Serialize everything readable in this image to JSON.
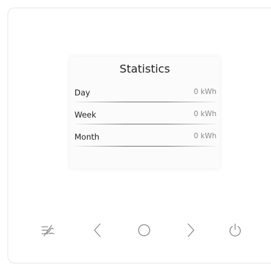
{
  "screen": {
    "title": "Statistics",
    "rows": [
      {
        "label": "Day",
        "value": "0 kWh"
      },
      {
        "label": "Week",
        "value": "0 kWh"
      },
      {
        "label": "Month",
        "value": "0 kWh"
      }
    ]
  },
  "buttons": [
    {
      "name": "fan-off-button",
      "icon": "fan-off-icon"
    },
    {
      "name": "previous-button",
      "icon": "chevron-left-icon"
    },
    {
      "name": "ok-button",
      "icon": "circle-icon"
    },
    {
      "name": "next-button",
      "icon": "chevron-right-icon"
    },
    {
      "name": "power-button",
      "icon": "power-icon"
    }
  ],
  "colors": {
    "icon": "#8a8a8a",
    "text": "#1f1f1f"
  }
}
